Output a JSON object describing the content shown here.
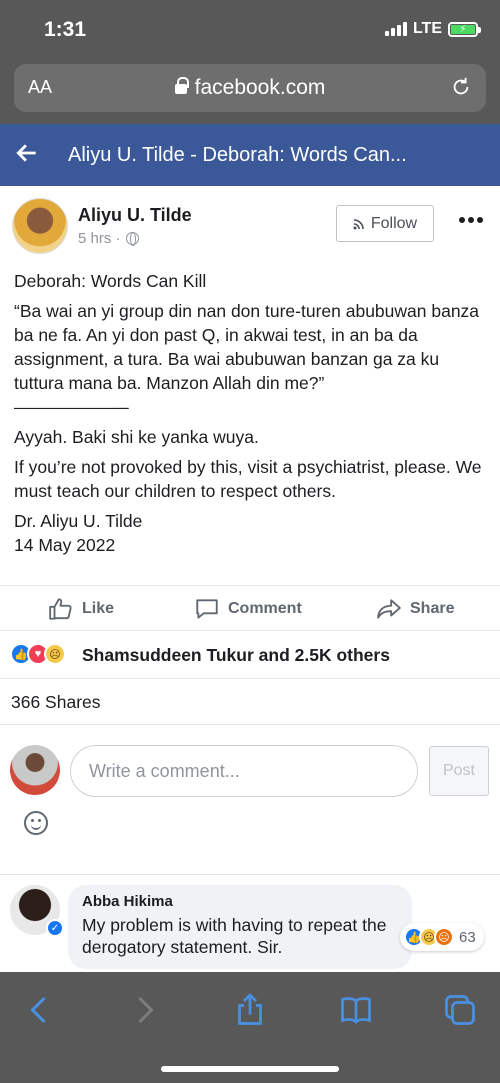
{
  "status_bar": {
    "time": "1:31",
    "network": "LTE"
  },
  "browser": {
    "aa_label": "AA",
    "url": "facebook.com"
  },
  "fb_header": {
    "title": "Aliyu U. Tilde - Deborah: Words Can..."
  },
  "post": {
    "author": "Aliyu U. Tilde",
    "time": "5 hrs ·",
    "follow_label": "Follow",
    "title": "Deborah: Words Can Kill",
    "quote": "“Ba wai an yi group din nan don ture-turen abubuwan banza ba ne fa. An yi don past Q, in akwai test, in an ba da assignment, a tura. Ba wai abubuwan banzan ga za ku tuttura mana ba. Manzon Allah din me?”",
    "separator": "——————–",
    "line2": "Ayyah. Baki shi ke yanka wuya.",
    "line3": "If you’re not provoked by this, visit a psychiatrist, please. We must teach our children to respect others.",
    "signature_name": "Dr. Aliyu U. Tilde",
    "signature_date": "14 May 2022"
  },
  "actions": {
    "like": "Like",
    "comment": "Comment",
    "share": "Share"
  },
  "reactions": {
    "summary": "Shamsuddeen Tukur and 2.5K others",
    "icons": [
      "like-icon",
      "love-icon",
      "sad-icon"
    ]
  },
  "shares": {
    "text": "366 Shares"
  },
  "composer": {
    "placeholder": "Write a comment...",
    "post_label": "Post"
  },
  "comment": {
    "name": "Abba Hikima",
    "text": "My problem is with having to repeat the derogatory statement. Sir.",
    "reaction_count": "63"
  },
  "colors": {
    "fb_blue": "#3b5998",
    "chrome_gray": "#585858",
    "link_blue": "#1877f2"
  }
}
